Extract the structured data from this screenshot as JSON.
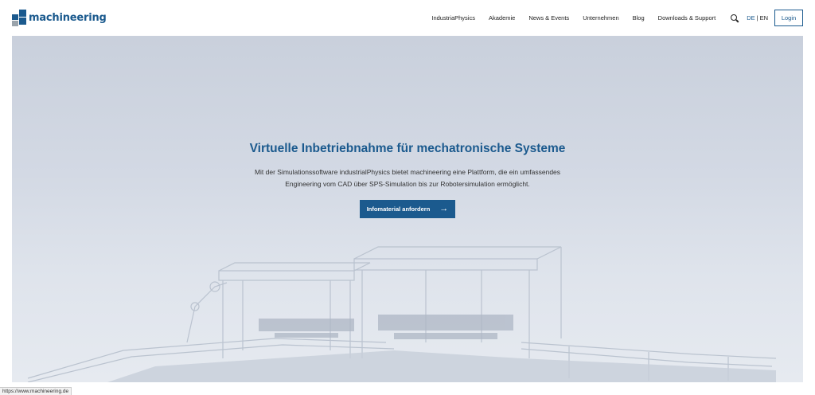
{
  "header": {
    "logo_text": "machineering",
    "nav": [
      {
        "label": "IndustriaPhysics"
      },
      {
        "label": "Akademie"
      },
      {
        "label": "News & Events"
      },
      {
        "label": "Unternehmen"
      },
      {
        "label": "Blog"
      },
      {
        "label": "Downloads & Support"
      }
    ],
    "search_icon": "search-icon",
    "lang": {
      "de": "DE",
      "sep": "|",
      "en": "EN"
    },
    "login_label": "Login"
  },
  "hero": {
    "title": "Virtuelle Inbetriebnahme für mechatronische Systeme",
    "text_line1": "Mit der Simulationssoftware industrialPhysics bietet machineering eine Plattform, die ein umfassendes",
    "text_line2": "Engineering vom CAD über SPS-Simulation bis zur Robotersimulation ermöglicht.",
    "cta_label": "Infomaterial anfordern",
    "cta_icon": "arrow-right-icon"
  },
  "statusbar": {
    "url": "https://www.machineering.de"
  },
  "colors": {
    "brand": "#1b5a8e",
    "hero_bg": "#d3d9e4"
  }
}
